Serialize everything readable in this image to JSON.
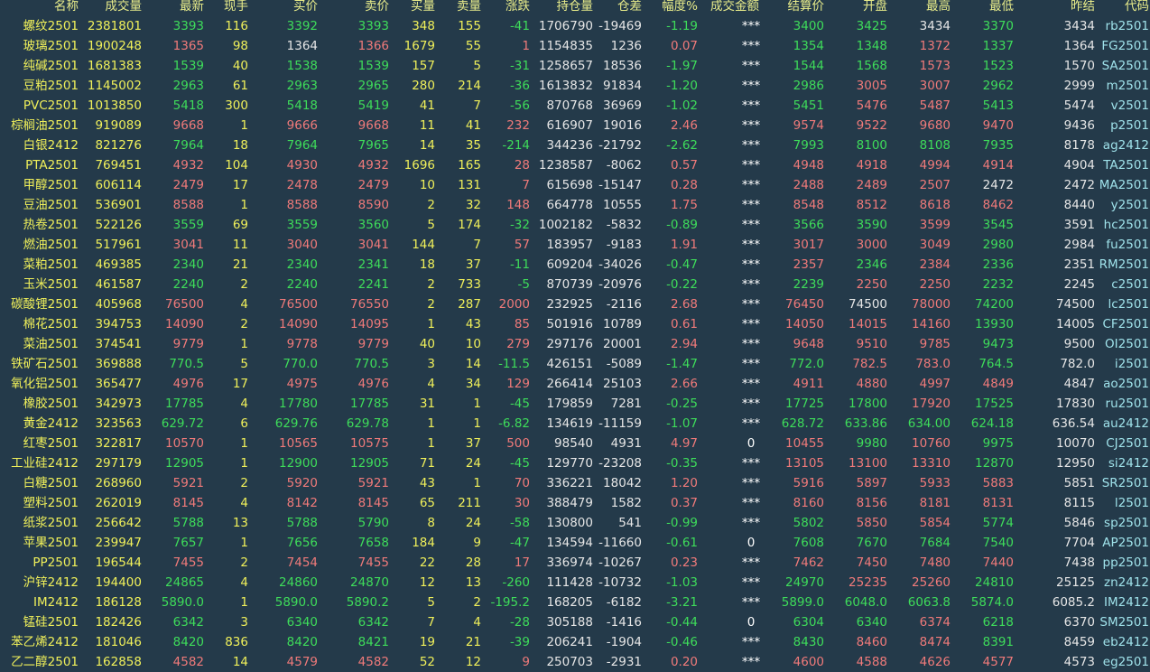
{
  "colors": {
    "background": "#243a4a",
    "up": "#f07a7a",
    "down": "#3edc5a",
    "neutral": "#e6e6e6",
    "header": "#e8ec8a",
    "name": "#f0f05a",
    "code": "#9fe2ea"
  },
  "headers": [
    "名称",
    "成交量",
    "最新",
    "现手",
    "买价",
    "卖价",
    "买量",
    "卖量",
    "涨跌",
    "持仓量",
    "仓差",
    "幅度%",
    "成交金额",
    "结算价",
    "开盘",
    "最高",
    "最低",
    "昨结",
    "代码"
  ],
  "rows": [
    [
      "螺纹2501",
      "2381801",
      "3393",
      "116",
      "3392",
      "3393",
      "348",
      "155",
      "-41",
      "1706790",
      "-19469",
      "-1.19",
      "***",
      "3400",
      "3425",
      "3434",
      "3370",
      "3434",
      "rb2501"
    ],
    [
      "玻璃2501",
      "1900248",
      "1365",
      "98",
      "1364",
      "1366",
      "1679",
      "55",
      "1",
      "1154835",
      "1236",
      "0.07",
      "***",
      "1354",
      "1348",
      "1372",
      "1337",
      "1364",
      "FG2501"
    ],
    [
      "纯碱2501",
      "1681383",
      "1539",
      "40",
      "1538",
      "1539",
      "157",
      "5",
      "-31",
      "1258657",
      "18536",
      "-1.97",
      "***",
      "1544",
      "1568",
      "1573",
      "1523",
      "1570",
      "SA2501"
    ],
    [
      "豆粕2501",
      "1145002",
      "2963",
      "61",
      "2963",
      "2965",
      "280",
      "214",
      "-36",
      "1613832",
      "91834",
      "-1.20",
      "***",
      "2986",
      "3005",
      "3007",
      "2962",
      "2999",
      "m2501"
    ],
    [
      "PVC2501",
      "1013850",
      "5418",
      "300",
      "5418",
      "5419",
      "41",
      "7",
      "-56",
      "870768",
      "36969",
      "-1.02",
      "***",
      "5451",
      "5476",
      "5487",
      "5413",
      "5474",
      "v2501"
    ],
    [
      "棕榈油2501",
      "919089",
      "9668",
      "1",
      "9666",
      "9668",
      "11",
      "41",
      "232",
      "616907",
      "19016",
      "2.46",
      "***",
      "9574",
      "9522",
      "9680",
      "9470",
      "9436",
      "p2501"
    ],
    [
      "白银2412",
      "821276",
      "7964",
      "18",
      "7964",
      "7965",
      "14",
      "35",
      "-214",
      "344236",
      "-21792",
      "-2.62",
      "***",
      "7993",
      "8100",
      "8108",
      "7935",
      "8178",
      "ag2412"
    ],
    [
      "PTA2501",
      "769451",
      "4932",
      "104",
      "4930",
      "4932",
      "1696",
      "165",
      "28",
      "1238587",
      "-8062",
      "0.57",
      "***",
      "4948",
      "4918",
      "4994",
      "4914",
      "4904",
      "TA2501"
    ],
    [
      "甲醇2501",
      "606114",
      "2479",
      "17",
      "2478",
      "2479",
      "10",
      "131",
      "7",
      "615698",
      "-15147",
      "0.28",
      "***",
      "2488",
      "2489",
      "2507",
      "2472",
      "2472",
      "MA2501"
    ],
    [
      "豆油2501",
      "536901",
      "8588",
      "1",
      "8588",
      "8590",
      "2",
      "32",
      "148",
      "664778",
      "10555",
      "1.75",
      "***",
      "8548",
      "8512",
      "8618",
      "8462",
      "8440",
      "y2501"
    ],
    [
      "热卷2501",
      "522126",
      "3559",
      "69",
      "3559",
      "3560",
      "5",
      "174",
      "-32",
      "1002182",
      "-5832",
      "-0.89",
      "***",
      "3566",
      "3590",
      "3599",
      "3545",
      "3591",
      "hc2501"
    ],
    [
      "燃油2501",
      "517961",
      "3041",
      "11",
      "3040",
      "3041",
      "144",
      "7",
      "57",
      "183957",
      "-9183",
      "1.91",
      "***",
      "3017",
      "3000",
      "3049",
      "2980",
      "2984",
      "fu2501"
    ],
    [
      "菜粕2501",
      "469385",
      "2340",
      "21",
      "2340",
      "2341",
      "18",
      "37",
      "-11",
      "609204",
      "-34026",
      "-0.47",
      "***",
      "2357",
      "2346",
      "2384",
      "2336",
      "2351",
      "RM2501"
    ],
    [
      "玉米2501",
      "461587",
      "2240",
      "2",
      "2240",
      "2241",
      "2",
      "733",
      "-5",
      "870739",
      "-20976",
      "-0.22",
      "***",
      "2239",
      "2250",
      "2250",
      "2232",
      "2245",
      "c2501"
    ],
    [
      "碳酸锂2501",
      "405968",
      "76500",
      "4",
      "76500",
      "76550",
      "2",
      "287",
      "2000",
      "232925",
      "-2116",
      "2.68",
      "***",
      "76450",
      "74500",
      "78000",
      "74200",
      "74500",
      "lc2501"
    ],
    [
      "棉花2501",
      "394753",
      "14090",
      "2",
      "14090",
      "14095",
      "1",
      "43",
      "85",
      "501916",
      "10789",
      "0.61",
      "***",
      "14050",
      "14015",
      "14160",
      "13930",
      "14005",
      "CF2501"
    ],
    [
      "菜油2501",
      "374541",
      "9779",
      "1",
      "9778",
      "9779",
      "40",
      "10",
      "279",
      "297176",
      "20001",
      "2.94",
      "***",
      "9648",
      "9510",
      "9785",
      "9473",
      "9500",
      "OI2501"
    ],
    [
      "铁矿石2501",
      "369888",
      "770.5",
      "5",
      "770.0",
      "770.5",
      "3",
      "14",
      "-11.5",
      "426151",
      "-5089",
      "-1.47",
      "***",
      "772.0",
      "782.5",
      "783.0",
      "764.5",
      "782.0",
      "i2501"
    ],
    [
      "氧化铝2501",
      "365477",
      "4976",
      "17",
      "4975",
      "4976",
      "4",
      "34",
      "129",
      "266414",
      "25103",
      "2.66",
      "***",
      "4911",
      "4880",
      "4997",
      "4849",
      "4847",
      "ao2501"
    ],
    [
      "橡胶2501",
      "342973",
      "17785",
      "4",
      "17780",
      "17785",
      "31",
      "1",
      "-45",
      "179859",
      "7281",
      "-0.25",
      "***",
      "17725",
      "17800",
      "17920",
      "17525",
      "17830",
      "ru2501"
    ],
    [
      "黄金2412",
      "323563",
      "629.72",
      "6",
      "629.76",
      "629.78",
      "1",
      "1",
      "-6.82",
      "134619",
      "-11159",
      "-1.07",
      "***",
      "628.72",
      "633.86",
      "634.00",
      "624.18",
      "636.54",
      "au2412"
    ],
    [
      "红枣2501",
      "322817",
      "10570",
      "1",
      "10565",
      "10575",
      "1",
      "37",
      "500",
      "98540",
      "4931",
      "4.97",
      "0",
      "10455",
      "9980",
      "10760",
      "9975",
      "10070",
      "CJ2501"
    ],
    [
      "工业硅2412",
      "297179",
      "12905",
      "1",
      "12900",
      "12905",
      "71",
      "24",
      "-45",
      "129770",
      "-23208",
      "-0.35",
      "***",
      "13105",
      "13100",
      "13310",
      "12870",
      "12950",
      "si2412"
    ],
    [
      "白糖2501",
      "268960",
      "5921",
      "2",
      "5920",
      "5921",
      "43",
      "1",
      "70",
      "336221",
      "18042",
      "1.20",
      "***",
      "5916",
      "5897",
      "5933",
      "5883",
      "5851",
      "SR2501"
    ],
    [
      "塑料2501",
      "262019",
      "8145",
      "4",
      "8142",
      "8145",
      "65",
      "211",
      "30",
      "388479",
      "1582",
      "0.37",
      "***",
      "8160",
      "8156",
      "8181",
      "8131",
      "8115",
      "l2501"
    ],
    [
      "纸浆2501",
      "256642",
      "5788",
      "13",
      "5788",
      "5790",
      "8",
      "24",
      "-58",
      "130800",
      "541",
      "-0.99",
      "***",
      "5802",
      "5850",
      "5854",
      "5774",
      "5846",
      "sp2501"
    ],
    [
      "苹果2501",
      "239947",
      "7657",
      "1",
      "7656",
      "7658",
      "184",
      "9",
      "-47",
      "134594",
      "-11660",
      "-0.61",
      "0",
      "7608",
      "7670",
      "7684",
      "7540",
      "7704",
      "AP2501"
    ],
    [
      "PP2501",
      "196544",
      "7455",
      "2",
      "7454",
      "7455",
      "22",
      "28",
      "17",
      "336974",
      "-10267",
      "0.23",
      "***",
      "7462",
      "7450",
      "7480",
      "7440",
      "7438",
      "pp2501"
    ],
    [
      "沪锌2412",
      "194400",
      "24865",
      "4",
      "24860",
      "24870",
      "12",
      "13",
      "-260",
      "111428",
      "-10732",
      "-1.03",
      "***",
      "24970",
      "25235",
      "25260",
      "24810",
      "25125",
      "zn2412"
    ],
    [
      "IM2412",
      "186128",
      "5890.0",
      "1",
      "5890.0",
      "5890.2",
      "5",
      "2",
      "-195.2",
      "168205",
      "-6182",
      "-3.21",
      "***",
      "5899.0",
      "6048.0",
      "6063.8",
      "5874.0",
      "6085.2",
      "IM2412"
    ],
    [
      "锰硅2501",
      "182426",
      "6342",
      "3",
      "6340",
      "6342",
      "7",
      "4",
      "-28",
      "305188",
      "-1416",
      "-0.44",
      "0",
      "6304",
      "6340",
      "6374",
      "6218",
      "6370",
      "SM2501"
    ],
    [
      "苯乙烯2412",
      "181046",
      "8420",
      "836",
      "8420",
      "8421",
      "19",
      "21",
      "-39",
      "206241",
      "-1904",
      "-0.46",
      "***",
      "8430",
      "8460",
      "8474",
      "8391",
      "8459",
      "eb2412"
    ],
    [
      "乙二醇2501",
      "162858",
      "4582",
      "14",
      "4579",
      "4582",
      "52",
      "12",
      "9",
      "250703",
      "-2931",
      "0.20",
      "***",
      "4600",
      "4588",
      "4626",
      "4577",
      "4573",
      "eg2501"
    ]
  ]
}
